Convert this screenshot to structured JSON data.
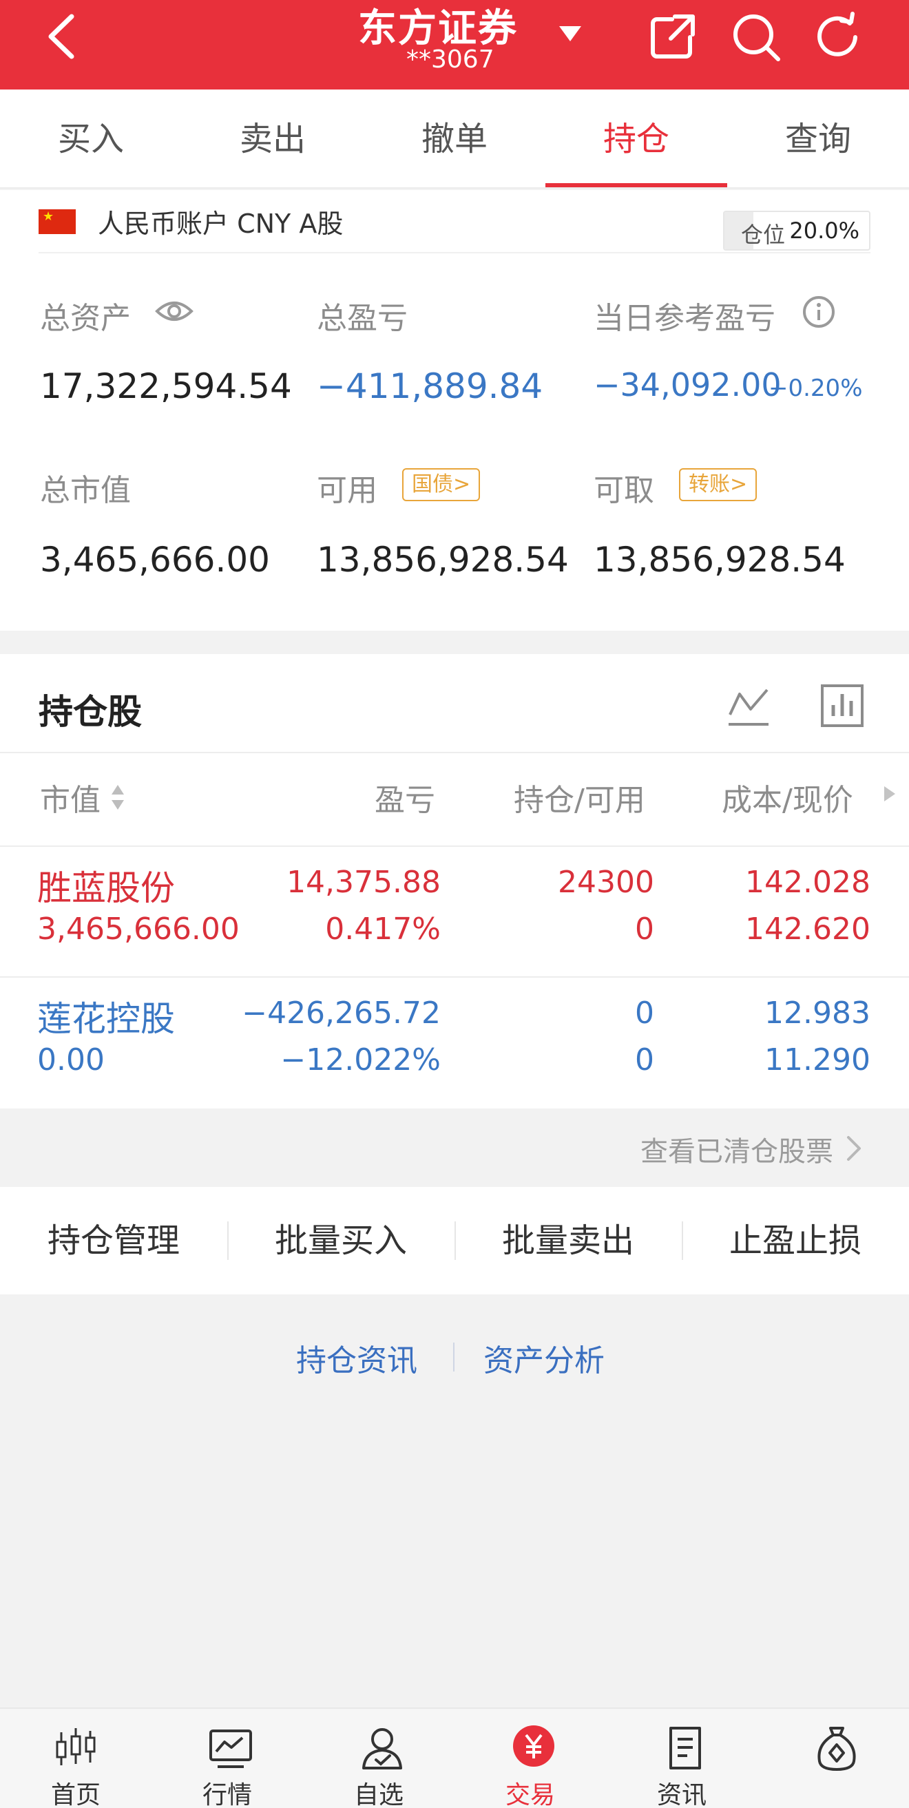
{
  "header": {
    "title": "东方证券",
    "account": "**3067"
  },
  "tabs": [
    {
      "label": "买入"
    },
    {
      "label": "卖出"
    },
    {
      "label": "撤单"
    },
    {
      "label": "持仓",
      "active": true
    },
    {
      "label": "查询"
    }
  ],
  "account": {
    "label": "人民币账户 CNY A股",
    "position_label": "仓位",
    "position_value": "20.0%",
    "position_fraction": 0.2
  },
  "summary": {
    "total_assets_label": "总资产",
    "total_assets": "17,322,594.54",
    "total_pnl_label": "总盈亏",
    "total_pnl": "−411,889.84",
    "daily_pnl_label": "当日参考盈亏",
    "daily_pnl": "−34,092.00",
    "daily_pnl_pct": "−0.20%",
    "market_value_label": "总市值",
    "market_value": "3,465,666.00",
    "available_label": "可用",
    "available_tag": "国债>",
    "available": "13,856,928.54",
    "withdrawable_label": "可取",
    "withdrawable_tag": "转账>",
    "withdrawable": "13,856,928.54"
  },
  "holdings": {
    "title": "持仓股",
    "columns": [
      "市值",
      "盈亏",
      "持仓/可用",
      "成本/现价"
    ],
    "rows": [
      {
        "name": "胜蓝股份",
        "market_value": "3,465,666.00",
        "pnl": "14,375.88",
        "pnl_pct": "0.417%",
        "position": "24300",
        "available": "0",
        "cost": "142.028",
        "price": "142.620",
        "tone": "red"
      },
      {
        "name": "莲花控股",
        "market_value": "0.00",
        "pnl": "−426,265.72",
        "pnl_pct": "−12.022%",
        "position": "0",
        "available": "0",
        "cost": "12.983",
        "price": "11.290",
        "tone": "blue"
      }
    ],
    "cleared_link": "查看已清仓股票"
  },
  "actions": [
    "持仓管理",
    "批量买入",
    "批量卖出",
    "止盈止损"
  ],
  "links": [
    "持仓资讯",
    "资产分析"
  ],
  "nav": [
    {
      "label": "首页",
      "icon": "candlestick-icon"
    },
    {
      "label": "行情",
      "icon": "chart-icon"
    },
    {
      "label": "自选",
      "icon": "user-check-icon"
    },
    {
      "label": "交易",
      "icon": "yuan-icon",
      "active": true
    },
    {
      "label": "资讯",
      "icon": "document-icon"
    },
    {
      "label": "",
      "icon": "money-bag-icon"
    }
  ],
  "colors": {
    "brand_red": "#e8303b",
    "profit_red": "#d9303a",
    "loss_blue": "#3a77c4",
    "tag_orange": "#e8a53a"
  }
}
